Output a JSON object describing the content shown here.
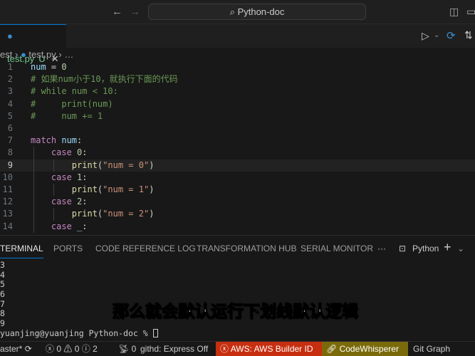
{
  "titlebar": {
    "search": "Python-doc",
    "back_icon": "arrow-left-icon",
    "forward_icon": "arrow-right-icon"
  },
  "tab": {
    "label": "test.py",
    "status": "U",
    "close": "✕"
  },
  "breadcrumb": {
    "folder": "est",
    "sep": "›",
    "file": "test.py",
    "more": "…"
  },
  "editor": {
    "lines": [
      {
        "n": "1",
        "html": "<span class='v'>num</span><span class='w'> = </span><span class='n'>0</span>"
      },
      {
        "n": "2",
        "html": "<span class='c'># 如果num小于10，就执行下面的代码</span>"
      },
      {
        "n": "3",
        "html": "<span class='c'># while num &lt; 10:</span>"
      },
      {
        "n": "4",
        "html": "<span class='c'>#     print(num)</span>"
      },
      {
        "n": "5",
        "html": "<span class='c'>#     num += 1</span>"
      },
      {
        "n": "6",
        "html": ""
      },
      {
        "n": "7",
        "html": "<span class='k'>match</span><span class='v'> num</span><span class='w'>:</span>"
      },
      {
        "n": "8",
        "html": "    <span class='k'>case</span> <span class='n'>0</span><span class='w'>:</span>"
      },
      {
        "n": "9",
        "html": "        <span class='f'>print</span><span class='w'>(</span><span class='s'>\"num = 0\"</span><span class='w'>)</span>"
      },
      {
        "n": "10",
        "html": "    <span class='k'>case</span> <span class='n'>1</span><span class='w'>:</span>"
      },
      {
        "n": "11",
        "html": "        <span class='f'>print</span><span class='w'>(</span><span class='s'>\"num = 1\"</span><span class='w'>)</span>"
      },
      {
        "n": "12",
        "html": "    <span class='k'>case</span> <span class='n'>2</span><span class='w'>:</span>"
      },
      {
        "n": "13",
        "html": "        <span class='f'>print</span><span class='w'>(</span><span class='s'>\"num = 2\"</span><span class='w'>)</span>"
      },
      {
        "n": "14",
        "html": "    <span class='k'>case</span> <span class='v'>_</span><span class='w'>:</span>"
      }
    ],
    "active_line": "9"
  },
  "panel": {
    "tabs": [
      "TERMINAL",
      "PORTS",
      "CODE REFERENCE LOG",
      "TRANSFORMATION HUB",
      "SERIAL MONITOR"
    ],
    "more": "···",
    "terminal_name": "Python",
    "add": "+"
  },
  "terminal": {
    "lines": [
      "3",
      "4",
      "5",
      "6",
      "7",
      "8",
      "9"
    ],
    "prompt": "yuanjing@yuanjing Python-doc % "
  },
  "subtitle": "那么就会默认运行下划线默认逻辑",
  "statusbar": {
    "branch": "aster*",
    "errors": "0",
    "warnings": "0",
    "info": "2",
    "ports": "0",
    "githd": "githd: Express Off",
    "aws": "AWS: AWS Builder ID",
    "codewhisperer": "CodeWhisperer",
    "gitgraph": "Git Graph",
    "aws_color": "#c72e0f",
    "cw_color": "#7a6a0a"
  }
}
